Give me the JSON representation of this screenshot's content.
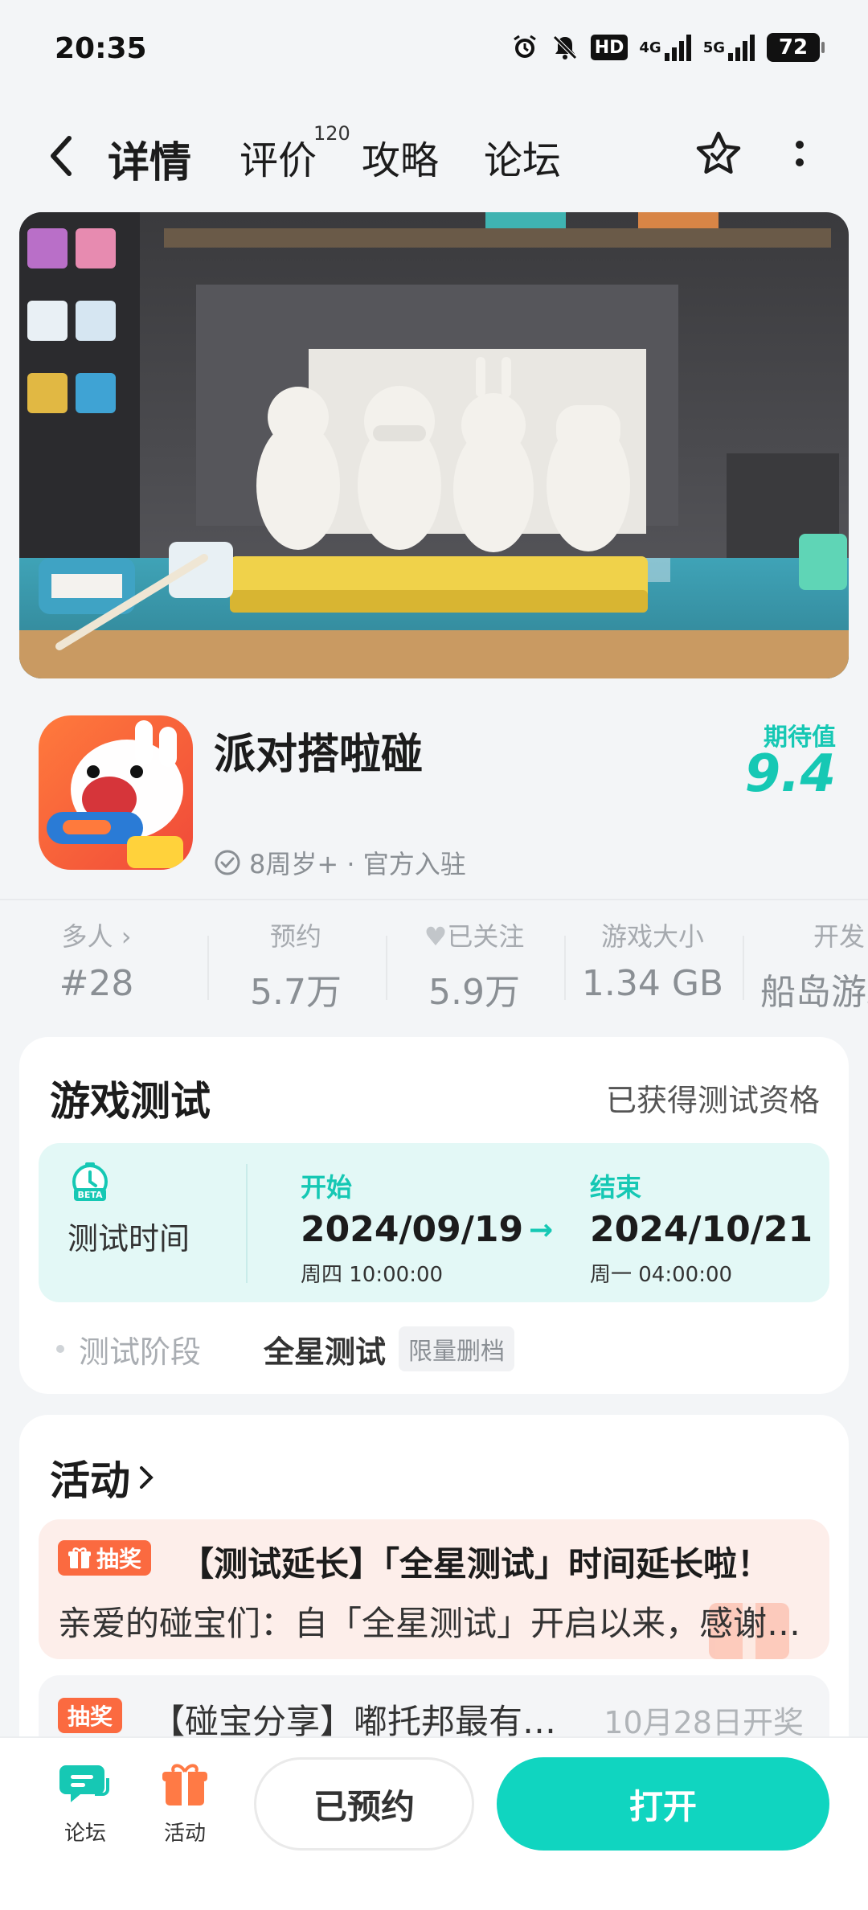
{
  "status_bar": {
    "time": "20:35",
    "hd": "HD",
    "net1": "4G",
    "net2": "5G",
    "battery": "72",
    "icons": [
      "alarm-icon",
      "bell-off-icon",
      "hd-icon",
      "signal-4g-icon",
      "signal-5g-icon",
      "battery-icon"
    ]
  },
  "nav": {
    "tabs": [
      {
        "label": "详情",
        "active": true
      },
      {
        "label": "评价",
        "count": "120"
      },
      {
        "label": "攻略"
      },
      {
        "label": "论坛"
      }
    ]
  },
  "app": {
    "name": "派对搭啦碰",
    "meta": "8周岁+ · 官方入驻",
    "expect_label": "期待值",
    "expect_value": "9.4"
  },
  "stats": [
    {
      "label": "多人",
      "value": "#28"
    },
    {
      "label": "预约",
      "value": "5.7万"
    },
    {
      "label": "已关注",
      "value": "5.9万"
    },
    {
      "label": "游戏大小",
      "value": "1.34 GB"
    },
    {
      "label": "开发",
      "value": "船岛游戏"
    }
  ],
  "test": {
    "title": "游戏测试",
    "qualification": "已获得测试资格",
    "time_label": "测试时间",
    "start_label": "开始",
    "start_date": "2024/09/19",
    "start_sub": "周四  10:00:00",
    "end_label": "结束",
    "end_date": "2024/10/21",
    "end_sub": "周一  04:00:00",
    "phase_label": "测试阶段",
    "phase_value": "全星测试",
    "phase_tag": "限量删档"
  },
  "activity": {
    "title": "活动",
    "items": [
      {
        "badge": "抽奖",
        "title": "【测试延长】「全星测试」时间延长啦！",
        "desc": "亲爱的碰宝们：自「全星测试」开启以来，感谢大家的支持"
      },
      {
        "badge": "抽奖",
        "title": "【碰宝分享】嘟托邦最有趣的瞬间",
        "date": "10月28日开奖"
      }
    ]
  },
  "bottom": {
    "forum": "论坛",
    "activity": "活动",
    "reserved": "已预约",
    "open": "打开"
  },
  "colors": {
    "accent": "#10d5c0",
    "badge": "#fb6a40",
    "highlight_bg": "#e3f8f6"
  }
}
